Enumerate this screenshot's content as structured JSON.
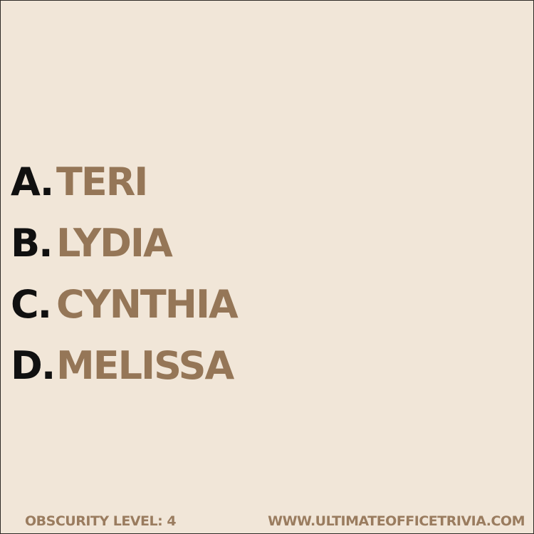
{
  "colors": {
    "background": "#f1e6d8",
    "border": "#2e2a26",
    "letter": "#101010",
    "answer": "#957657",
    "footer": "#9a7c5f"
  },
  "options": [
    {
      "letter": "A.",
      "text": "TERI"
    },
    {
      "letter": "B.",
      "text": "LYDIA"
    },
    {
      "letter": "C.",
      "text": "CYNTHIA"
    },
    {
      "letter": "D.",
      "text": "MELISSA"
    }
  ],
  "footer": {
    "obscurity": "OBSCURITY LEVEL: 4",
    "website": "WWW.ULTIMATEOFFICETRIVIA.COM"
  }
}
